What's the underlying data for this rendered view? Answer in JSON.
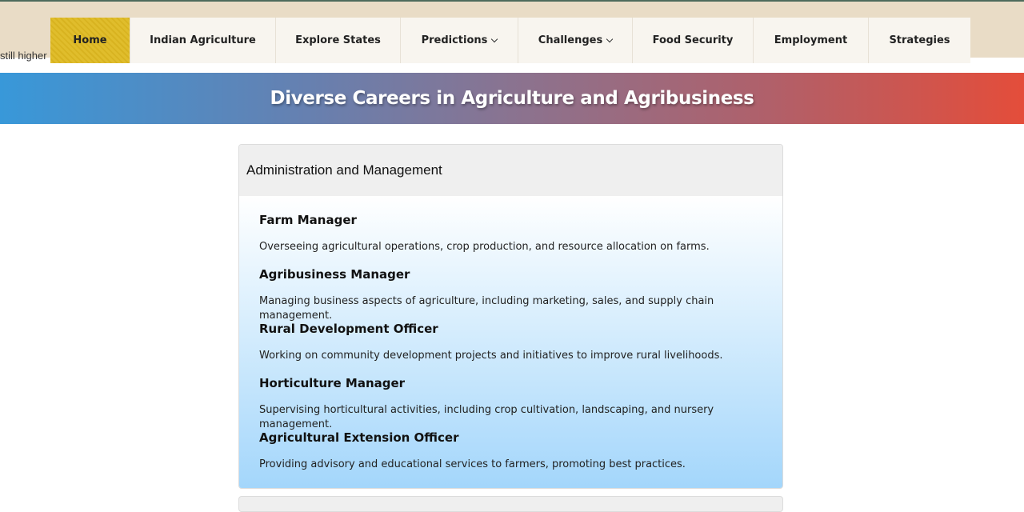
{
  "page": {
    "stray_text": "still higher"
  },
  "nav": {
    "items": [
      {
        "label": "Home",
        "active": true
      },
      {
        "label": "Indian Agriculture"
      },
      {
        "label": "Explore States"
      },
      {
        "label": "Predictions",
        "dropdown": true
      },
      {
        "label": "Challenges",
        "dropdown": true
      },
      {
        "label": "Food Security"
      },
      {
        "label": "Employment"
      },
      {
        "label": "Strategies"
      }
    ],
    "active_color": "#e0bd2c"
  },
  "banner": {
    "title": "Diverse Careers in Agriculture and Agribusiness",
    "gradient_start": "#3898d9",
    "gradient_end": "#e44d3a"
  },
  "section": {
    "heading": "Administration and Management",
    "jobs": [
      {
        "title": "Farm Manager",
        "desc": "Overseeing agricultural operations, crop production, and resource allocation on farms."
      },
      {
        "title": "Agribusiness Manager",
        "desc": "Managing business aspects of agriculture, including marketing, sales, and supply chain management."
      },
      {
        "title": "Rural Development Officer",
        "desc": "Working on community development projects and initiatives to improve rural livelihoods."
      },
      {
        "title": "Horticulture Manager",
        "desc": "Supervising horticultural activities, including crop cultivation, landscaping, and nursery management."
      },
      {
        "title": "Agricultural Extension Officer",
        "desc": "Providing advisory and educational services to farmers, promoting best practices."
      }
    ]
  }
}
